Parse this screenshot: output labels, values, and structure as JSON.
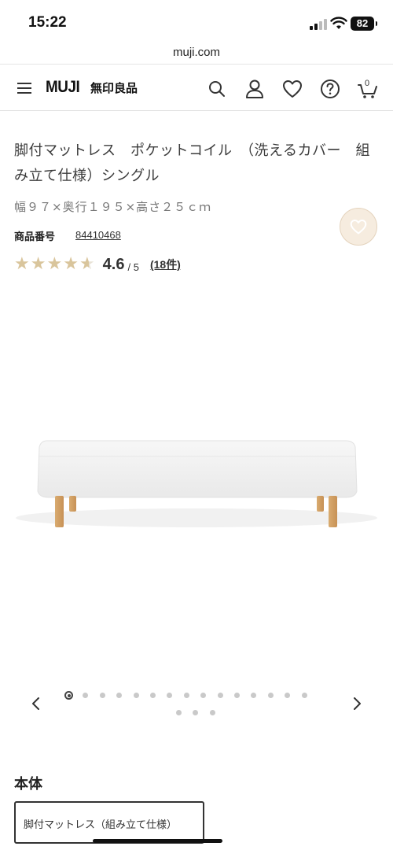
{
  "status_bar": {
    "time": "15:22",
    "battery": "82"
  },
  "browser": {
    "url": "muji.com"
  },
  "header": {
    "logo_latin": "MUJI",
    "logo_kanji": "無印良品",
    "cart_count": "0"
  },
  "product": {
    "title": "脚付マットレス　ポケットコイル　（洗えるカバー　組み立て仕様）シングル",
    "size": "幅９７×奥行１９５×高さ２５ｃｍ",
    "number_label": "商品番号",
    "number_value": "84410468",
    "rating": {
      "value": "4.6",
      "max": "/ 5",
      "reviews": "(18件)",
      "score_fraction": 0.92
    }
  },
  "carousel": {
    "total_images": 18,
    "active_index": 0
  },
  "section": {
    "title": "本体",
    "option_label": "脚付マットレス（組み立て仕様）"
  },
  "colors": {
    "star": "#d9c59c",
    "fav_bg": "#f6ecdf",
    "text": "#3c3c3c"
  }
}
